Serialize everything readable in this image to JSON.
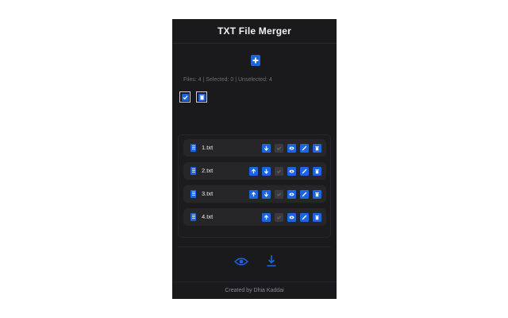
{
  "app": {
    "title": "TXT File Merger"
  },
  "stats": {
    "text": "Files: 4 | Selected: 0 | Unselected: 4"
  },
  "files": [
    {
      "name": "1.txt"
    },
    {
      "name": "2.txt"
    },
    {
      "name": "3.txt"
    },
    {
      "name": "4.txt"
    }
  ],
  "icons": {
    "add": "file-plus-icon",
    "select_all": "check-square-icon",
    "delete_all": "trash-icon",
    "file": "file-text-icon",
    "up": "arrow-up-icon",
    "down": "arrow-down-icon",
    "check": "check-icon",
    "view": "eye-icon",
    "edit": "pencil-icon",
    "delete": "trash-icon",
    "preview": "eye-icon",
    "download": "download-icon"
  },
  "colors": {
    "accent": "#1e64e0",
    "panel": "#1a1a1c",
    "row": "#262629"
  },
  "footer": {
    "text": "Created by Dhia Kaddai"
  }
}
